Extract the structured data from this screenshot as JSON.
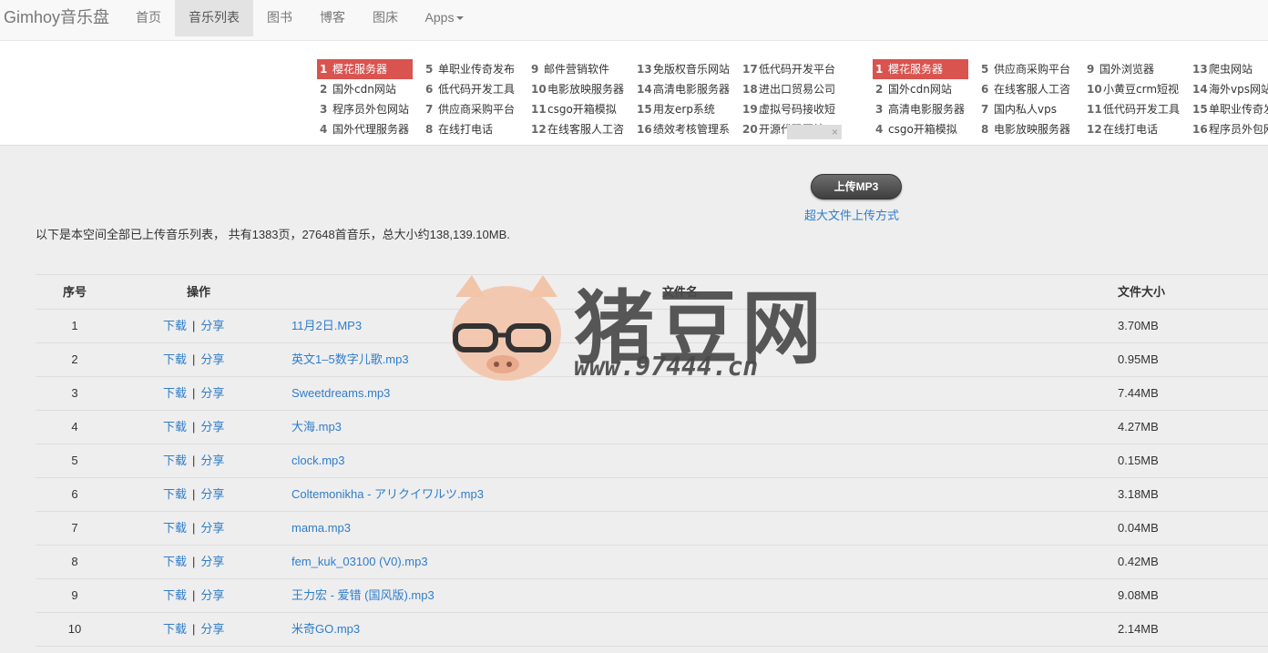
{
  "navbar": {
    "brand": "Gimhoy音乐盘",
    "items": [
      "首页",
      "音乐列表",
      "图书",
      "博客",
      "图床",
      "Apps"
    ],
    "active": "音乐列表"
  },
  "ads": {
    "left": [
      [
        [
          "1",
          "樱花服务器"
        ],
        [
          "2",
          "国外cdn网站"
        ],
        [
          "3",
          "程序员外包网站"
        ],
        [
          "4",
          "国外代理服务器"
        ]
      ],
      [
        [
          "5",
          "单职业传奇发布"
        ],
        [
          "6",
          "低代码开发工具"
        ],
        [
          "7",
          "供应商采购平台"
        ],
        [
          "8",
          "在线打电话"
        ]
      ],
      [
        [
          "9",
          "邮件营销软件"
        ],
        [
          "10",
          "电影放映服务器"
        ],
        [
          "11",
          "csgo开箱模拟"
        ],
        [
          "12",
          "在线客服人工咨"
        ]
      ],
      [
        [
          "13",
          "免版权音乐网站"
        ],
        [
          "14",
          "高清电影服务器"
        ],
        [
          "15",
          "用友erp系统"
        ],
        [
          "16",
          "绩效考核管理系"
        ]
      ],
      [
        [
          "17",
          "低代码开发平台"
        ],
        [
          "18",
          "进出口贸易公司"
        ],
        [
          "19",
          "虚拟号码接收短"
        ],
        [
          "20",
          "开源代码网站"
        ]
      ]
    ],
    "right": [
      [
        [
          "1",
          "樱花服务器"
        ],
        [
          "2",
          "国外cdn网站"
        ],
        [
          "3",
          "高清电影服务器"
        ],
        [
          "4",
          "csgo开箱模拟"
        ]
      ],
      [
        [
          "5",
          "供应商采购平台"
        ],
        [
          "6",
          "在线客服人工咨"
        ],
        [
          "7",
          "国内私人vps"
        ],
        [
          "8",
          "电影放映服务器"
        ]
      ],
      [
        [
          "9",
          "国外浏览器"
        ],
        [
          "10",
          "小黄豆crm短视"
        ],
        [
          "11",
          "低代码开发工具"
        ],
        [
          "12",
          "在线打电话"
        ]
      ],
      [
        [
          "13",
          "爬虫网站"
        ],
        [
          "14",
          "海外vps网站"
        ],
        [
          "15",
          "单职业传奇发"
        ],
        [
          "16",
          "程序员外包网"
        ]
      ]
    ],
    "tag_close": "×"
  },
  "upload": {
    "button": "上传MP3",
    "link": "超大文件上传方式"
  },
  "summary": "以下是本空间全部已上传音乐列表， 共有1383页，27648首音乐，总大小约138,139.10MB.",
  "table": {
    "headers": {
      "no": "序号",
      "op": "操作",
      "name": "文件名",
      "size": "文件大小"
    },
    "download_label": "下载",
    "share_label": "分享",
    "sep": "|",
    "rows": [
      {
        "no": "1",
        "name": "11月2日.MP3",
        "size": "3.70MB"
      },
      {
        "no": "2",
        "name": "英文1–5数字儿歌.mp3",
        "size": "0.95MB"
      },
      {
        "no": "3",
        "name": "Sweetdreams.mp3",
        "size": "7.44MB"
      },
      {
        "no": "4",
        "name": "大海.mp3",
        "size": "4.27MB"
      },
      {
        "no": "5",
        "name": "clock.mp3",
        "size": "0.15MB"
      },
      {
        "no": "6",
        "name": "Coltemonikha - アリクイワルツ.mp3",
        "size": "3.18MB"
      },
      {
        "no": "7",
        "name": "mama.mp3",
        "size": "0.04MB"
      },
      {
        "no": "8",
        "name": "fem_kuk_03100 (V0).mp3",
        "size": "0.42MB"
      },
      {
        "no": "9",
        "name": "王力宏 - 爱错 (国风版).mp3",
        "size": "9.08MB"
      },
      {
        "no": "10",
        "name": "米奇GO.mp3",
        "size": "2.14MB"
      }
    ]
  },
  "watermark": {
    "text": "猪豆网",
    "url": "www.97444.cn"
  },
  "colors": {
    "link": "#2f7dcb",
    "highlight": "#d9534f",
    "background": "#eeeeee"
  }
}
